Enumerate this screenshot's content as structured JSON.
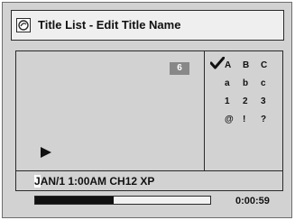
{
  "header": {
    "title": "Title List - Edit Title Name",
    "icon": "disc-icon"
  },
  "preview": {
    "title_number": "6",
    "play_icon": "play-icon"
  },
  "char_panel": {
    "selected_icon": "checkmark-icon",
    "rows": [
      [
        "A",
        "B",
        "C"
      ],
      [
        "a",
        "b",
        "c"
      ],
      [
        "1",
        "2",
        "3"
      ],
      [
        "@",
        "!",
        "?"
      ]
    ]
  },
  "info": {
    "cursor_char": "J",
    "rest": "AN/1 1:00AM CH12 XP"
  },
  "progress": {
    "fraction": 0.45,
    "time": "0:00:59"
  }
}
